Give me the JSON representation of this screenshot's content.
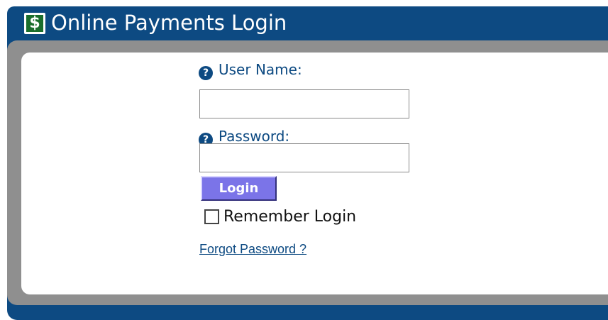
{
  "header": {
    "logo_glyph": "$",
    "title": "Online Payments Login"
  },
  "form": {
    "username": {
      "label": "User Name:",
      "help_glyph": "?",
      "value": "",
      "placeholder": ""
    },
    "password": {
      "label": "Password:",
      "help_glyph": "?",
      "value": "",
      "placeholder": ""
    },
    "login_label": "Login",
    "remember_label": "Remember Login",
    "remember_checked": false,
    "forgot_link": "Forgot Password ?"
  },
  "colors": {
    "brand_blue": "#0d4a82",
    "frame_gray": "#8f8f8f",
    "button_purple": "#7b74e8",
    "logo_green": "#1b6e2c"
  },
  "icons": {
    "logo": "dollar-logo-icon",
    "help": "question-circle-icon",
    "checkbox": "checkbox-unchecked-icon"
  }
}
